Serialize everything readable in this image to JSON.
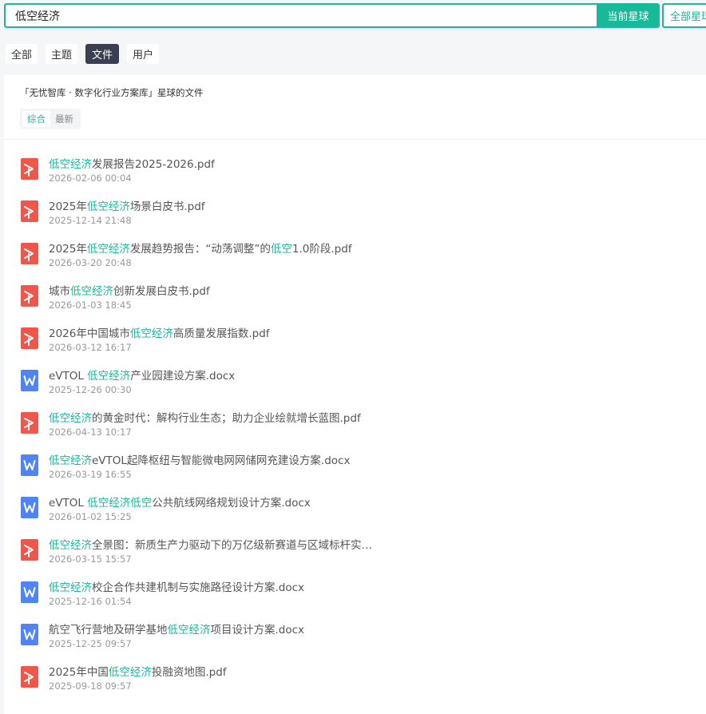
{
  "search": {
    "value": "低空经济",
    "current_btn": "当前星球",
    "all_btn": "全部星球"
  },
  "type_tabs": [
    "全部",
    "主题",
    "文件",
    "用户"
  ],
  "panel": {
    "title": "「无忧智库 · 数字化行业方案库」星球的文件",
    "sort_tabs": [
      "综合",
      "最新"
    ]
  },
  "colors": {
    "accent": "#16b998",
    "pdf": "#f0574a",
    "doc": "#4f84f4",
    "active_tab": "#3a3f51"
  },
  "files": [
    {
      "icon": "pdf-icon",
      "parts": [
        {
          "t": "低空经济",
          "h": true
        },
        {
          "t": "发展报告2025-2026.pdf",
          "h": false
        }
      ],
      "date": "2026-02-06 00:04"
    },
    {
      "icon": "pdf-icon",
      "parts": [
        {
          "t": "2025年",
          "h": false
        },
        {
          "t": "低空经济",
          "h": true
        },
        {
          "t": "场景白皮书.pdf",
          "h": false
        }
      ],
      "date": "2025-12-14 21:48"
    },
    {
      "icon": "pdf-icon",
      "parts": [
        {
          "t": "2025年",
          "h": false
        },
        {
          "t": "低空经济",
          "h": true
        },
        {
          "t": "发展趋势报告：“动荡调整”的",
          "h": false
        },
        {
          "t": "低空",
          "h": true
        },
        {
          "t": "1.0阶段.pdf",
          "h": false
        }
      ],
      "date": "2026-03-20 20:48"
    },
    {
      "icon": "pdf-icon",
      "parts": [
        {
          "t": "城市",
          "h": false
        },
        {
          "t": "低空经济",
          "h": true
        },
        {
          "t": "创新发展白皮书.pdf",
          "h": false
        }
      ],
      "date": "2026-01-03 18:45"
    },
    {
      "icon": "pdf-icon",
      "parts": [
        {
          "t": "2026年中国城市",
          "h": false
        },
        {
          "t": "低空经济",
          "h": true
        },
        {
          "t": "高质量发展指数.pdf",
          "h": false
        }
      ],
      "date": "2026-03-12 16:17"
    },
    {
      "icon": "doc-icon",
      "parts": [
        {
          "t": "eVTOL ",
          "h": false
        },
        {
          "t": "低空经济",
          "h": true
        },
        {
          "t": "产业园建设方案.docx",
          "h": false
        }
      ],
      "date": "2025-12-26 00:30"
    },
    {
      "icon": "pdf-icon",
      "parts": [
        {
          "t": "低空经济",
          "h": true
        },
        {
          "t": "的黄金时代：解构行业生态；助力企业绘就增长蓝图.pdf",
          "h": false
        }
      ],
      "date": "2026-04-13 10:17"
    },
    {
      "icon": "doc-icon",
      "parts": [
        {
          "t": "低空经济",
          "h": true
        },
        {
          "t": "eVTOL起降枢纽与智能微电网网储网充建设方案.docx",
          "h": false
        }
      ],
      "date": "2026-03-19 16:55"
    },
    {
      "icon": "doc-icon",
      "parts": [
        {
          "t": "eVTOL ",
          "h": false
        },
        {
          "t": "低空经济低空",
          "h": true
        },
        {
          "t": "公共航线网络规划设计方案.docx",
          "h": false
        }
      ],
      "date": "2026-01-02 15:25"
    },
    {
      "icon": "pdf-icon",
      "parts": [
        {
          "t": "低空经济",
          "h": true
        },
        {
          "t": "全景图：新质生产力驱动下的万亿级新赛道与区域标杆实…",
          "h": false
        }
      ],
      "date": "2026-03-15 15:57"
    },
    {
      "icon": "doc-icon",
      "parts": [
        {
          "t": "低空经济",
          "h": true
        },
        {
          "t": "校企合作共建机制与实施路径设计方案.docx",
          "h": false
        }
      ],
      "date": "2025-12-16 01:54"
    },
    {
      "icon": "doc-icon",
      "parts": [
        {
          "t": "航空飞行营地及研学基地",
          "h": false
        },
        {
          "t": "低空经济",
          "h": true
        },
        {
          "t": "项目设计方案.docx",
          "h": false
        }
      ],
      "date": "2025-12-25 09:57"
    },
    {
      "icon": "pdf-icon",
      "parts": [
        {
          "t": "2025年中国",
          "h": false
        },
        {
          "t": "低空经济",
          "h": true
        },
        {
          "t": "投融资地图.pdf",
          "h": false
        }
      ],
      "date": "2025-09-18 09:57"
    }
  ]
}
